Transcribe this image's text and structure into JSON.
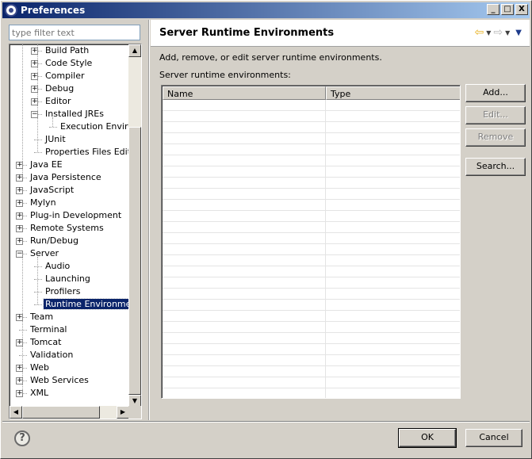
{
  "window": {
    "title": "Preferences",
    "controls": {
      "minimize": "_",
      "maximize": "□",
      "close": "X"
    }
  },
  "filter": {
    "placeholder": "type filter text",
    "value": ""
  },
  "tree": {
    "items": [
      {
        "label": "Build Path",
        "level": 2,
        "expander": "+"
      },
      {
        "label": "Code Style",
        "level": 2,
        "expander": "+"
      },
      {
        "label": "Compiler",
        "level": 2,
        "expander": "+"
      },
      {
        "label": "Debug",
        "level": 2,
        "expander": "+"
      },
      {
        "label": "Editor",
        "level": 2,
        "expander": "+"
      },
      {
        "label": "Installed JREs",
        "level": 2,
        "expander": "−"
      },
      {
        "label": "Execution Environr",
        "level": 3,
        "expander": ""
      },
      {
        "label": "JUnit",
        "level": 2,
        "expander": ""
      },
      {
        "label": "Properties Files Editor",
        "level": 2,
        "expander": ""
      },
      {
        "label": "Java EE",
        "level": 1,
        "expander": "+"
      },
      {
        "label": "Java Persistence",
        "level": 1,
        "expander": "+"
      },
      {
        "label": "JavaScript",
        "level": 1,
        "expander": "+"
      },
      {
        "label": "Mylyn",
        "level": 1,
        "expander": "+"
      },
      {
        "label": "Plug-in Development",
        "level": 1,
        "expander": "+"
      },
      {
        "label": "Remote Systems",
        "level": 1,
        "expander": "+"
      },
      {
        "label": "Run/Debug",
        "level": 1,
        "expander": "+"
      },
      {
        "label": "Server",
        "level": 1,
        "expander": "−"
      },
      {
        "label": "Audio",
        "level": 2,
        "expander": ""
      },
      {
        "label": "Launching",
        "level": 2,
        "expander": ""
      },
      {
        "label": "Profilers",
        "level": 2,
        "expander": ""
      },
      {
        "label": "Runtime Environments",
        "level": 2,
        "expander": "",
        "selected": true
      },
      {
        "label": "Team",
        "level": 1,
        "expander": "+"
      },
      {
        "label": "Terminal",
        "level": 1,
        "expander": ""
      },
      {
        "label": "Tomcat",
        "level": 1,
        "expander": "+"
      },
      {
        "label": "Validation",
        "level": 1,
        "expander": ""
      },
      {
        "label": "Web",
        "level": 1,
        "expander": "+"
      },
      {
        "label": "Web Services",
        "level": 1,
        "expander": "+"
      },
      {
        "label": "XML",
        "level": 1,
        "expander": "+"
      }
    ]
  },
  "page": {
    "title": "Server Runtime Environments",
    "description": "Add, remove, or edit server runtime environments.",
    "list_label": "Server runtime environments:",
    "columns": [
      "Name",
      "Type"
    ],
    "rows": []
  },
  "buttons": {
    "add": "Add...",
    "edit": "Edit...",
    "remove": "Remove",
    "search": "Search...",
    "ok": "OK",
    "cancel": "Cancel"
  },
  "help": {
    "glyph": "?"
  },
  "icons": {
    "back": "back-arrow-icon",
    "forward": "forward-arrow-icon",
    "menu": "view-menu-icon",
    "help": "help-icon"
  },
  "colors": {
    "selection": "#0a246a",
    "back_arrow": "#e7b01e"
  }
}
